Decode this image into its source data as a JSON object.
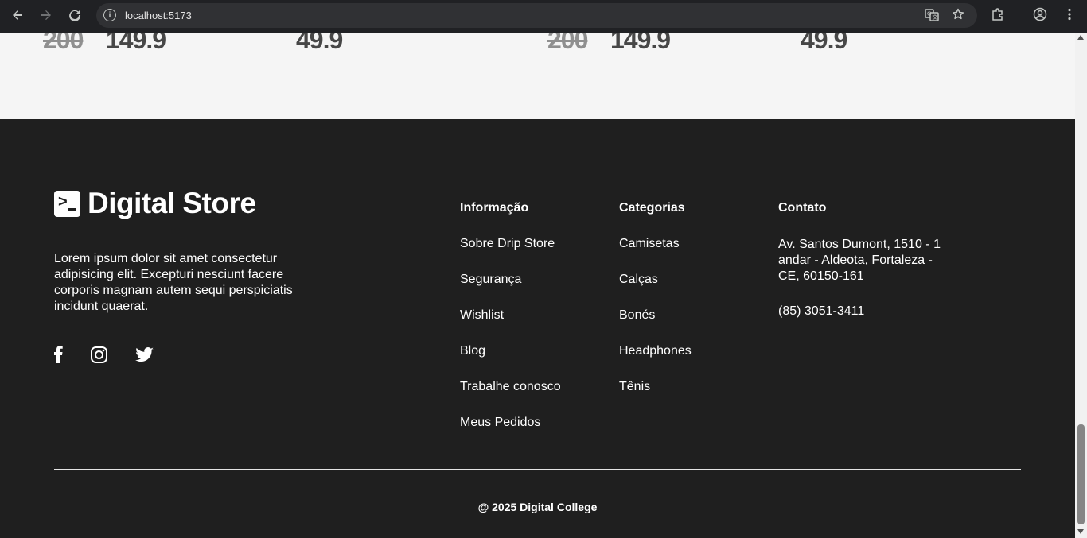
{
  "browser": {
    "url": "localhost:5173",
    "icons": {
      "back": "arrow-left-icon",
      "forward": "arrow-right-icon",
      "reload": "reload-icon",
      "site_info": "info-icon",
      "translate": "translate-icon",
      "bookmark": "star-icon",
      "extensions": "puzzle-icon",
      "profile": "profile-icon",
      "menu": "kebab-menu-icon"
    }
  },
  "products": [
    {
      "old_price": "200",
      "price": "149.9"
    },
    {
      "old_price": "",
      "price": "49.9"
    },
    {
      "old_price": "200",
      "price": "149.9"
    },
    {
      "old_price": "",
      "price": "49.9"
    }
  ],
  "footer": {
    "brand": "Digital Store",
    "description": "Lorem ipsum dolor sit amet consectetur adipisicing elit. Excepturi nesciunt facere corporis magnam autem sequi perspiciatis incidunt quaerat.",
    "social": [
      "facebook-icon",
      "instagram-icon",
      "twitter-icon"
    ],
    "info": {
      "title": "Informação",
      "items": [
        "Sobre Drip Store",
        "Segurança",
        "Wishlist",
        "Blog",
        "Trabalhe conosco",
        "Meus Pedidos"
      ]
    },
    "categories": {
      "title": "Categorias",
      "items": [
        "Camisetas",
        "Calças",
        "Bonés",
        "Headphones",
        "Tênis"
      ]
    },
    "contact": {
      "title": "Contato",
      "address": "Av. Santos Dumont, 1510 - 1 andar - Aldeota, Fortaleza - CE, 60150-161",
      "phone": "(85) 3051-3411"
    },
    "copyright": "@ 2025 Digital College"
  },
  "colors": {
    "footer_bg": "#1f1f1f",
    "page_bg": "#f5f5f5",
    "price_text": "#474747",
    "old_price_text": "#8f8f8f"
  }
}
